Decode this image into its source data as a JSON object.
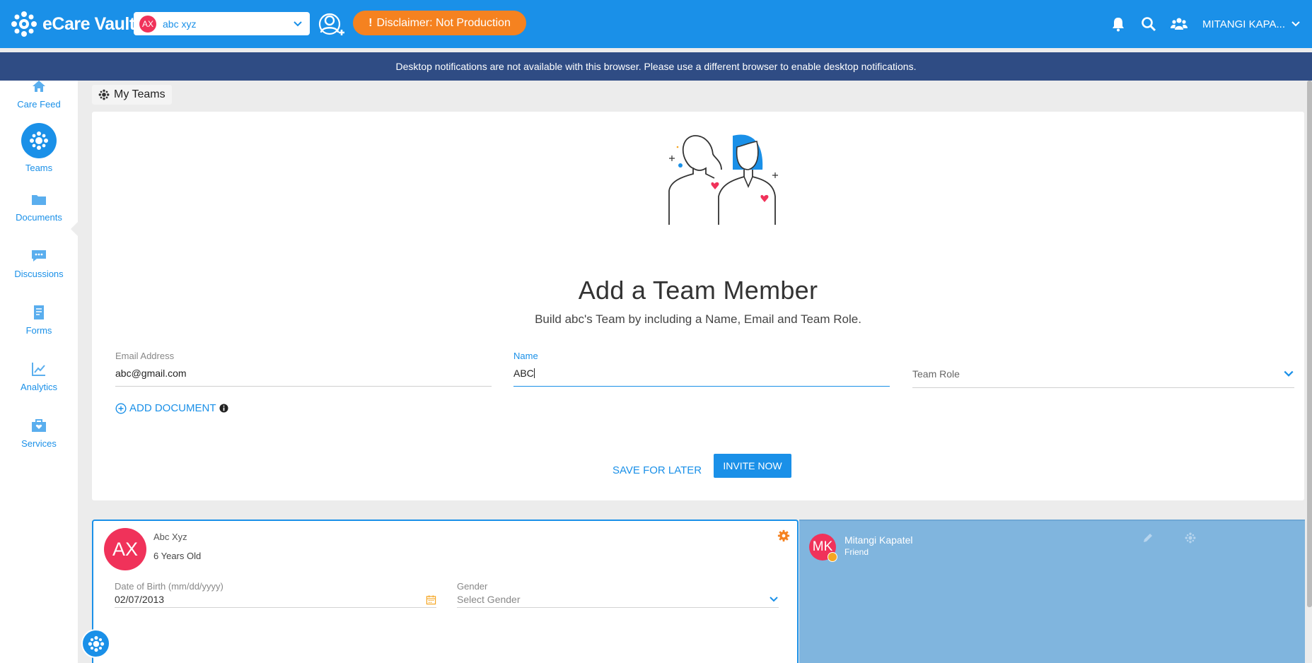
{
  "app": {
    "title": "eCare Vault"
  },
  "header": {
    "patient": {
      "initials": "AX",
      "name": "abc xyz"
    },
    "disclaimer": "Disclaimer: Not Production",
    "user_name": "MITANGI KAPA..."
  },
  "banner": "Desktop notifications are not available with this browser. Please use a different browser to enable desktop notifications.",
  "sidebar": {
    "items": [
      {
        "label": "Care Feed",
        "icon": "home-icon"
      },
      {
        "label": "Teams",
        "icon": "teams-icon",
        "active": true
      },
      {
        "label": "Documents",
        "icon": "folder-icon"
      },
      {
        "label": "Discussions",
        "icon": "chat-icon"
      },
      {
        "label": "Forms",
        "icon": "form-icon"
      },
      {
        "label": "Analytics",
        "icon": "chart-icon"
      },
      {
        "label": "Services",
        "icon": "briefcase-icon"
      }
    ]
  },
  "breadcrumb": "My Teams",
  "form": {
    "title": "Add a Team Member",
    "subtitle": "Build abc's Team by including a Name, Email and Team Role.",
    "email": {
      "label": "Email Address",
      "value": "abc@gmail.com"
    },
    "name": {
      "label": "Name",
      "value": "ABC"
    },
    "role": {
      "placeholder": "Team Role"
    },
    "add_document": "ADD DOCUMENT",
    "save_later": "SAVE FOR LATER",
    "invite_now": "INVITE NOW"
  },
  "profile": {
    "initials": "AX",
    "name": "Abc Xyz",
    "age": "6 Years Old",
    "dob": {
      "label": "Date of Birth (mm/dd/yyyy)",
      "value": "02/07/2013"
    },
    "gender": {
      "label": "Gender",
      "placeholder": "Select Gender"
    }
  },
  "team_member": {
    "initials": "MK",
    "name": "Mitangi Kapatel",
    "role": "Friend"
  },
  "colors": {
    "primary": "#1a90e8",
    "banner": "#2f4c84",
    "accent": "#f58220",
    "avatar": "#f0325a",
    "team_panel": "#80b5de"
  }
}
